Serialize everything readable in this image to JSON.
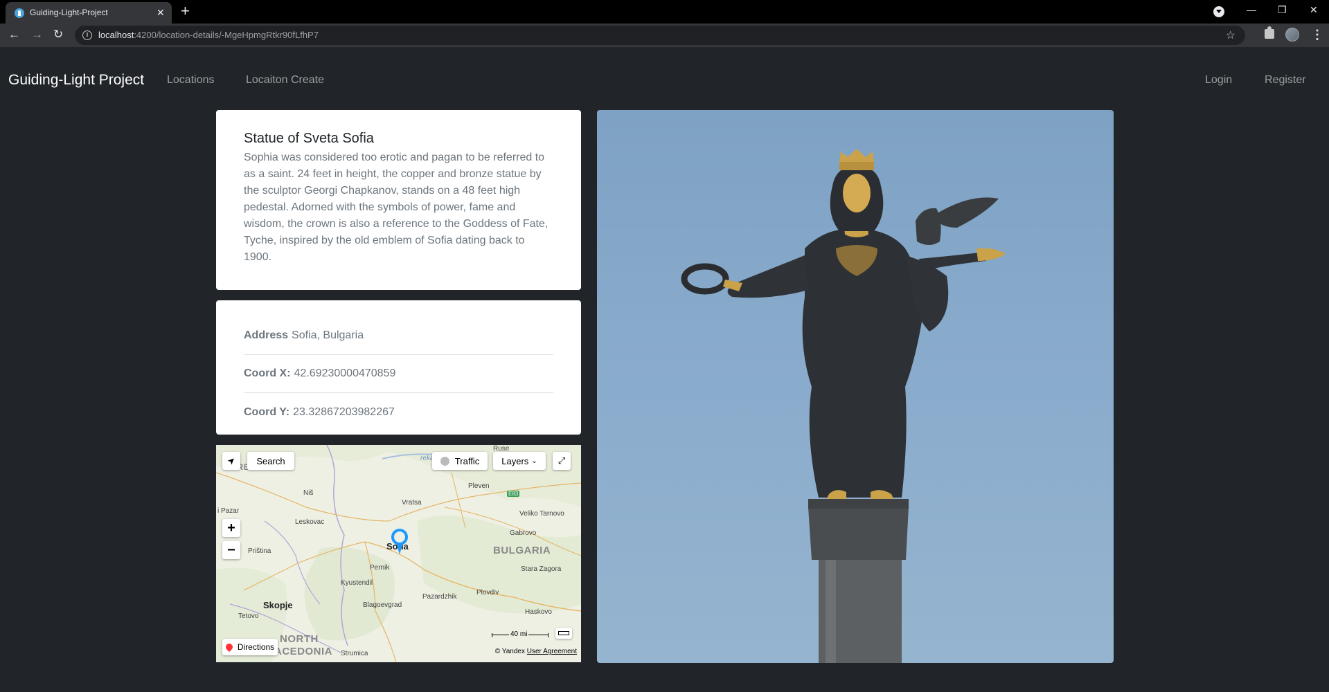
{
  "browser": {
    "tab_title": "Guiding-Light-Project",
    "tab_close": "✕",
    "new_tab": "+",
    "url_host": "localhost",
    "url_path": ":4200/location-details/-MgeHpmgRtkr90fLfhP7",
    "window_controls": {
      "minimize": "—",
      "maximize": "❐",
      "close": "✕"
    },
    "icons": [
      "back-icon",
      "forward-icon",
      "reload-icon",
      "info-icon",
      "star-icon",
      "extensions-icon",
      "profile-icon",
      "menu-icon"
    ]
  },
  "navbar": {
    "brand": "Guiding-Light Project",
    "links": [
      "Locations",
      "Locaiton Create"
    ],
    "auth_links": [
      "Login",
      "Register"
    ]
  },
  "location": {
    "title": "Statue of Sveta Sofia",
    "description": "Sophia was considered too erotic and pagan to be referred to as a saint. 24 feet in height, the copper and bronze statue by the sculptor Georgi Chapkanov, stands on a 48 feet high pedestal. Adorned with the symbols of power, fame and wisdom, the crown is also a reference to the Goddess of Fate, Tyche, inspired by the old emblem of Sofia dating back to 1900.",
    "address_label": "Address",
    "address": "Sofia, Bulgaria",
    "coord_x_label": "Coord X:",
    "coord_x": "42.69230000470859",
    "coord_y_label": "Coord Y:",
    "coord_y": "23.32867203982267"
  },
  "map": {
    "search_label": "Search",
    "traffic_label": "Traffic",
    "layers_label": "Layers",
    "directions_label": "Directions",
    "scale_label": "40 mi",
    "attribution": "© Yandex",
    "agreement": "User Agreement",
    "places": {
      "ruse": "Ruse",
      "srbija": "SRBIJA",
      "pleven": "Pleven",
      "nis": "Niš",
      "vratsa": "Vratsa",
      "e83": "E83",
      "pazar": "i Pazar",
      "veliko": "Veliko Tarnovo",
      "leskovac": "Leskovac",
      "gabrovo": "Gabrovo",
      "pristina": "Priština",
      "sofia": "Sofia",
      "bulgaria": "BULGARIA",
      "pernik": "Pernik",
      "stara": "Stara Zagora",
      "kyustendil": "Kyustendil",
      "skopje": "Skopje",
      "plovdiv": "Plovdiv",
      "pazardzhik": "Pazardzhik",
      "blagoevgrad": "Blagoevgrad",
      "tetovo": "Tetovo",
      "haskovo": "Haskovo",
      "north": "NORTH",
      "macedonia": "ACEDONIA",
      "strumica": "Strumica",
      "reka": "reka"
    }
  }
}
